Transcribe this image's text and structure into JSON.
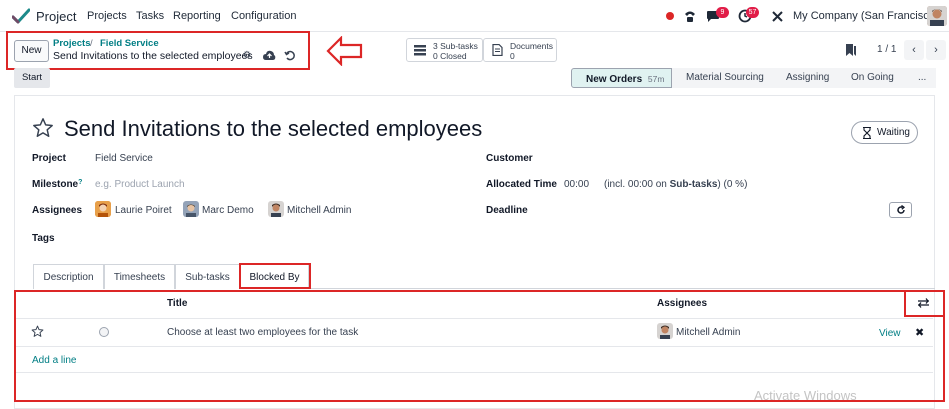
{
  "navbar": {
    "app_name": "Project",
    "menu": [
      "Projects",
      "Tasks",
      "Reporting",
      "Configuration"
    ],
    "messages_count": "9",
    "activities_count": "57",
    "company": "My Company (San Francisco)"
  },
  "control_panel": {
    "new_label": "New",
    "breadcrumb": [
      "Projects",
      "Field Service"
    ],
    "breadcrumb_separator": "/",
    "record_title": "Send Invitations to the selected employees",
    "smart_buttons": [
      {
        "line1": "3 Sub-tasks",
        "line2": "0 Closed",
        "icon": "list-icon"
      },
      {
        "line1": "Documents",
        "line2": "0",
        "icon": "document-icon"
      }
    ],
    "pager": "1 / 1"
  },
  "statusbar": {
    "start_label": "Start",
    "stages": [
      {
        "label": "New Orders",
        "extra": "57m",
        "active": true
      },
      {
        "label": "Material Sourcing",
        "extra": "",
        "active": false
      },
      {
        "label": "Assigning",
        "extra": "",
        "active": false
      },
      {
        "label": "On Going",
        "extra": "",
        "active": false
      },
      {
        "label": "...",
        "extra": "",
        "active": false
      }
    ]
  },
  "form": {
    "title": "Send Invitations to the selected employees",
    "waiting_label": "Waiting",
    "fields": {
      "project_label": "Project",
      "project_value": "Field Service",
      "milestone_label": "Milestone",
      "milestone_help": "?",
      "milestone_placeholder": "e.g. Product Launch",
      "assignees_label": "Assignees",
      "assignees": [
        "Laurie Poiret",
        "Marc Demo",
        "Mitchell Admin"
      ],
      "tags_label": "Tags",
      "customer_label": "Customer",
      "allocated_label": "Allocated Time",
      "allocated_value": "00:00",
      "allocated_incl_prefix": "(incl. 00:00 on ",
      "allocated_incl_bold": "Sub-tasks",
      "allocated_incl_suffix": ") (0 %)",
      "deadline_label": "Deadline"
    },
    "tabs": [
      "Description",
      "Timesheets",
      "Sub-tasks",
      "Blocked By"
    ],
    "active_tab": "Blocked By"
  },
  "blocked_by_table": {
    "columns": [
      "Title",
      "Assignees"
    ],
    "rows": [
      {
        "title": "Choose at least two employees for the task",
        "assignee": "Mitchell Admin",
        "action": "View"
      }
    ],
    "add_line": "Add a line"
  },
  "watermark": "Activate Windows",
  "colors": {
    "accent": "#017e84",
    "highlight": "#dc2626",
    "brand": "#714b67"
  }
}
